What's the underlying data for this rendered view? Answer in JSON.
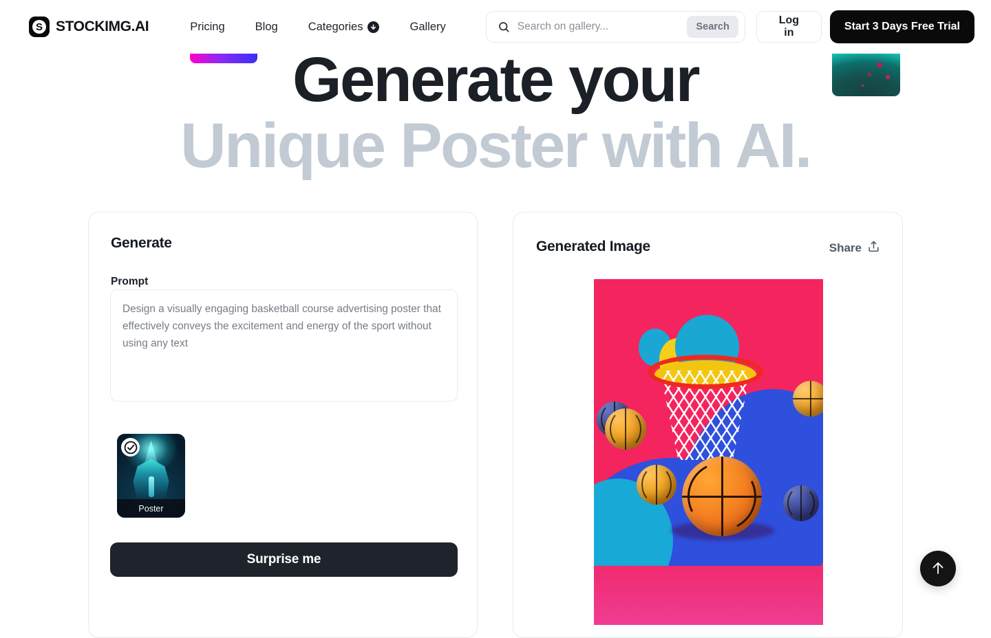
{
  "header": {
    "brand": {
      "mark_letter": "S",
      "name": "STOCKIMG.AI"
    },
    "nav": [
      {
        "label": "Pricing",
        "has_caret": false
      },
      {
        "label": "Blog",
        "has_caret": false
      },
      {
        "label": "Categories",
        "has_caret": true
      },
      {
        "label": "Gallery",
        "has_caret": false
      }
    ],
    "search": {
      "value": "",
      "placeholder": "Search on gallery...",
      "button_label": "Search"
    },
    "login_label": "Log in",
    "trial_label": "Start 3 Days Free Trial"
  },
  "hero": {
    "line1": "Generate your",
    "line2": "Unique Poster with AI.",
    "gradient_chip_colors": [
      "#ff00c8",
      "#8b2bf5",
      "#3b30f5"
    ],
    "teal_chip_color": "#13bfb4"
  },
  "generate_panel": {
    "title": "Generate",
    "prompt_label": "Prompt",
    "prompt_value": "",
    "prompt_placeholder": "Design a visually engaging basketball course advertising poster that effectively conveys the excitement and energy of the sport without using any text",
    "style_card": {
      "caption": "Poster",
      "selected": true
    },
    "surprise_label": "Surprise me"
  },
  "result_panel": {
    "title": "Generated Image",
    "share_label": "Share"
  },
  "colors": {
    "dark": "#1f242c",
    "black": "#0a0a0a",
    "muted_heading": "#c2cad3",
    "border": "#e9eaee",
    "search_btn_bg": "#e8eaee"
  },
  "scroll_top": {
    "name": "arrow-up-icon"
  }
}
